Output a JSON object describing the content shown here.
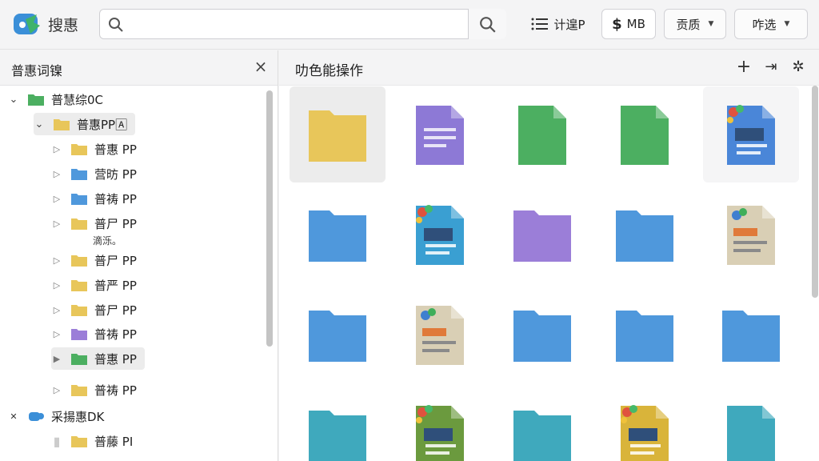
{
  "app": {
    "name": "搜惠"
  },
  "search": {
    "placeholder": "",
    "value": ""
  },
  "toolbar": {
    "list_label": "计遑P",
    "mb_label": "MB",
    "dropdown1_label": "贡质",
    "dropdown2_label": "咋选"
  },
  "sidebar": {
    "title": "普惠词镍",
    "items": [
      {
        "label": "普慧综0C",
        "icon": "folder-green",
        "arrow": "open",
        "indent": 0
      },
      {
        "label": "普惠PP🄰",
        "icon": "folder-yellow",
        "arrow": "open",
        "indent": 1,
        "selected": true
      },
      {
        "label": "普惠 PP",
        "icon": "folder-yellow",
        "arrow": "closed",
        "indent": 2
      },
      {
        "label": "营昉 PP",
        "icon": "folder-blue",
        "arrow": "closed",
        "indent": 2
      },
      {
        "label": "普祷 PP",
        "icon": "folder-blue",
        "arrow": "closed",
        "indent": 2
      },
      {
        "label": "普尸 PP",
        "icon": "folder-yellow",
        "arrow": "closed",
        "indent": 2
      },
      {
        "label": "普尸 PP",
        "icon": "folder-yellow",
        "arrow": "closed",
        "indent": 2
      },
      {
        "label": "普严 PP",
        "icon": "folder-yellow",
        "arrow": "closed",
        "indent": 2
      },
      {
        "label": "普尸 PP",
        "icon": "folder-yellow",
        "arrow": "closed",
        "indent": 2
      },
      {
        "label": "普祷 PP",
        "icon": "folder-purple",
        "arrow": "closed",
        "indent": 2
      },
      {
        "label": "普惠 PP",
        "icon": "folder-green",
        "arrow": "filled",
        "indent": 2,
        "selected": true
      },
      {
        "label": "普祷 PP",
        "icon": "folder-yellow",
        "arrow": "closed",
        "indent": 2
      },
      {
        "label": "采揚惠DK",
        "icon": "cloud-icon",
        "arrow": "x",
        "indent": 0
      },
      {
        "label": "普藤 PI",
        "icon": "folder-yellow",
        "arrow": "doc",
        "indent": 2
      }
    ],
    "note": "滴泺。"
  },
  "main": {
    "title": "叻色能操作",
    "actions": {
      "add": "+",
      "collapse": "⇥",
      "pin": "✲"
    },
    "items": [
      {
        "kind": "folder",
        "color": "#e8c65a",
        "selected": true
      },
      {
        "kind": "doc",
        "color": "#8d79d6"
      },
      {
        "kind": "doc-plain",
        "color": "#4caf61"
      },
      {
        "kind": "doc-plain",
        "color": "#4caf61"
      },
      {
        "kind": "doc-fancy",
        "color": "#4a86d8",
        "highlight": true
      },
      {
        "kind": "folder",
        "color": "#4f98dc"
      },
      {
        "kind": "doc-fancy",
        "color": "#3a9fd2"
      },
      {
        "kind": "folder",
        "color": "#9b7ed8"
      },
      {
        "kind": "folder",
        "color": "#4f98dc"
      },
      {
        "kind": "doc-beige",
        "color": "#d9cfb5"
      },
      {
        "kind": "folder",
        "color": "#4f98dc"
      },
      {
        "kind": "doc-beige",
        "color": "#d9cfb5"
      },
      {
        "kind": "folder",
        "color": "#4f98dc"
      },
      {
        "kind": "folder",
        "color": "#4f98dc"
      },
      {
        "kind": "folder",
        "color": "#4f98dc"
      },
      {
        "kind": "folder",
        "color": "#3fa9bd"
      },
      {
        "kind": "doc-fancy",
        "color": "#6b9a3e"
      },
      {
        "kind": "folder",
        "color": "#3fa9bd"
      },
      {
        "kind": "doc-fancy",
        "color": "#d9b43a"
      },
      {
        "kind": "doc-plain",
        "color": "#3fa9bd"
      }
    ]
  },
  "colors": {
    "accent": "#3b82c4",
    "folder_yellow": "#e8c65a",
    "folder_blue": "#4f98dc",
    "folder_green": "#4caf61",
    "folder_purple": "#9b7ed8"
  }
}
